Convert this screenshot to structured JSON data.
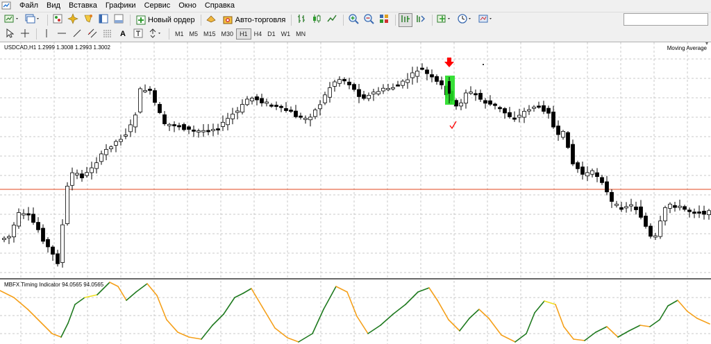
{
  "menu": {
    "items": [
      "Файл",
      "Вид",
      "Вставка",
      "Графики",
      "Сервис",
      "Окно",
      "Справка"
    ]
  },
  "toolbar": {
    "new_order_label": "Новый ордер",
    "autotrading_label": "Авто-торговля",
    "search_value": ""
  },
  "timeframes": [
    "M1",
    "M5",
    "M15",
    "M30",
    "H1",
    "H4",
    "D1",
    "W1",
    "MN"
  ],
  "active_timeframe": "H1",
  "chart": {
    "title": "USDCAD,H1  1.2999 1.3008 1.2993 1.3002",
    "indicator_label": "Moving Average",
    "subwindow_title": "MBFX Timing Indicator 94.0565 94.0565",
    "colors": {
      "bull_body": "#ffffff",
      "bear_body": "#000000",
      "wick": "#000000",
      "grid": "#c8c8c8",
      "level_line": "#e0441e",
      "highlight": "#22dd22",
      "arrow": "#ff0000",
      "osc_green": "#1f7a1f",
      "osc_orange": "#f5a01a",
      "osc_yellow": "#f0e020"
    }
  },
  "icons": [
    "new-chart-icon",
    "profiles-icon",
    "navigator-icon",
    "crosshair-icon",
    "market-watch-icon",
    "data-window-icon",
    "terminal-icon",
    "strategy-tester-icon",
    "new-order-icon",
    "autotrading-icon",
    "bar-chart-icon",
    "candlestick-icon",
    "line-chart-icon",
    "zoom-in-icon",
    "zoom-out-icon",
    "tile-windows-icon",
    "autoscroll-icon",
    "chart-shift-icon",
    "indicators-icon",
    "periods-icon",
    "templates-icon",
    "cursor-icon",
    "crosshair-tool-icon",
    "vertical-line-icon",
    "horizontal-line-icon",
    "trendline-icon",
    "equidistant-channel-icon",
    "fibonacci-icon",
    "text-icon",
    "text-label-icon",
    "arrows-icon"
  ]
}
